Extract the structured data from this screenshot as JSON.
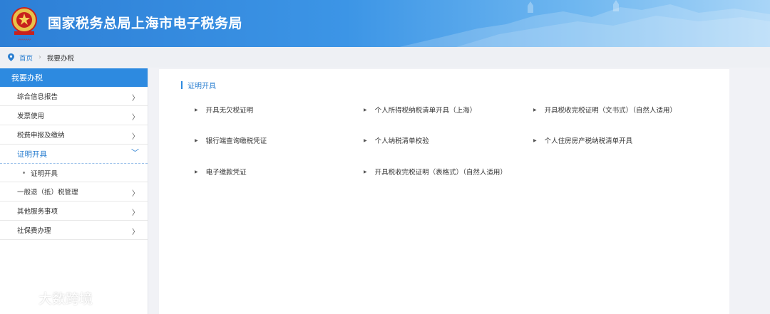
{
  "header": {
    "title": "国家税务总局上海市电子税务局",
    "emblem_icon": "tax-emblem-icon"
  },
  "breadcrumb": {
    "home": "首页",
    "separator": "›",
    "current": "我要办税"
  },
  "sidebar": {
    "heading": "我要办税",
    "items": [
      {
        "label": "综合信息报告",
        "arrow": "〉"
      },
      {
        "label": "发票使用",
        "arrow": "〉"
      },
      {
        "label": "税费申报及缴纳",
        "arrow": "〉"
      },
      {
        "label": "证明开具",
        "arrow": "﹀"
      },
      {
        "label": "一般退（抵）税管理",
        "arrow": "〉"
      },
      {
        "label": "其他服务事项",
        "arrow": "〉"
      },
      {
        "label": "社保费办理",
        "arrow": "〉"
      }
    ],
    "sub_items": [
      {
        "label": "证明开具"
      }
    ]
  },
  "main": {
    "section_title": "证明开具",
    "links": [
      "开具无欠税证明",
      "个人所得税纳税清单开具（上海）",
      "开具税收完税证明（文书式）（自然人适用）",
      "银行端查询缴税凭证",
      "个人纳税清单校验",
      "个人住房房产税纳税清单开具",
      "电子缴款凭证",
      "开具税收完税证明（表格式）（自然人适用）"
    ]
  },
  "watermark": {
    "text": "大数跨境"
  },
  "colors": {
    "primary": "#2d8ae0",
    "link_active": "#2b7fd0",
    "background": "#f1f2f6"
  }
}
